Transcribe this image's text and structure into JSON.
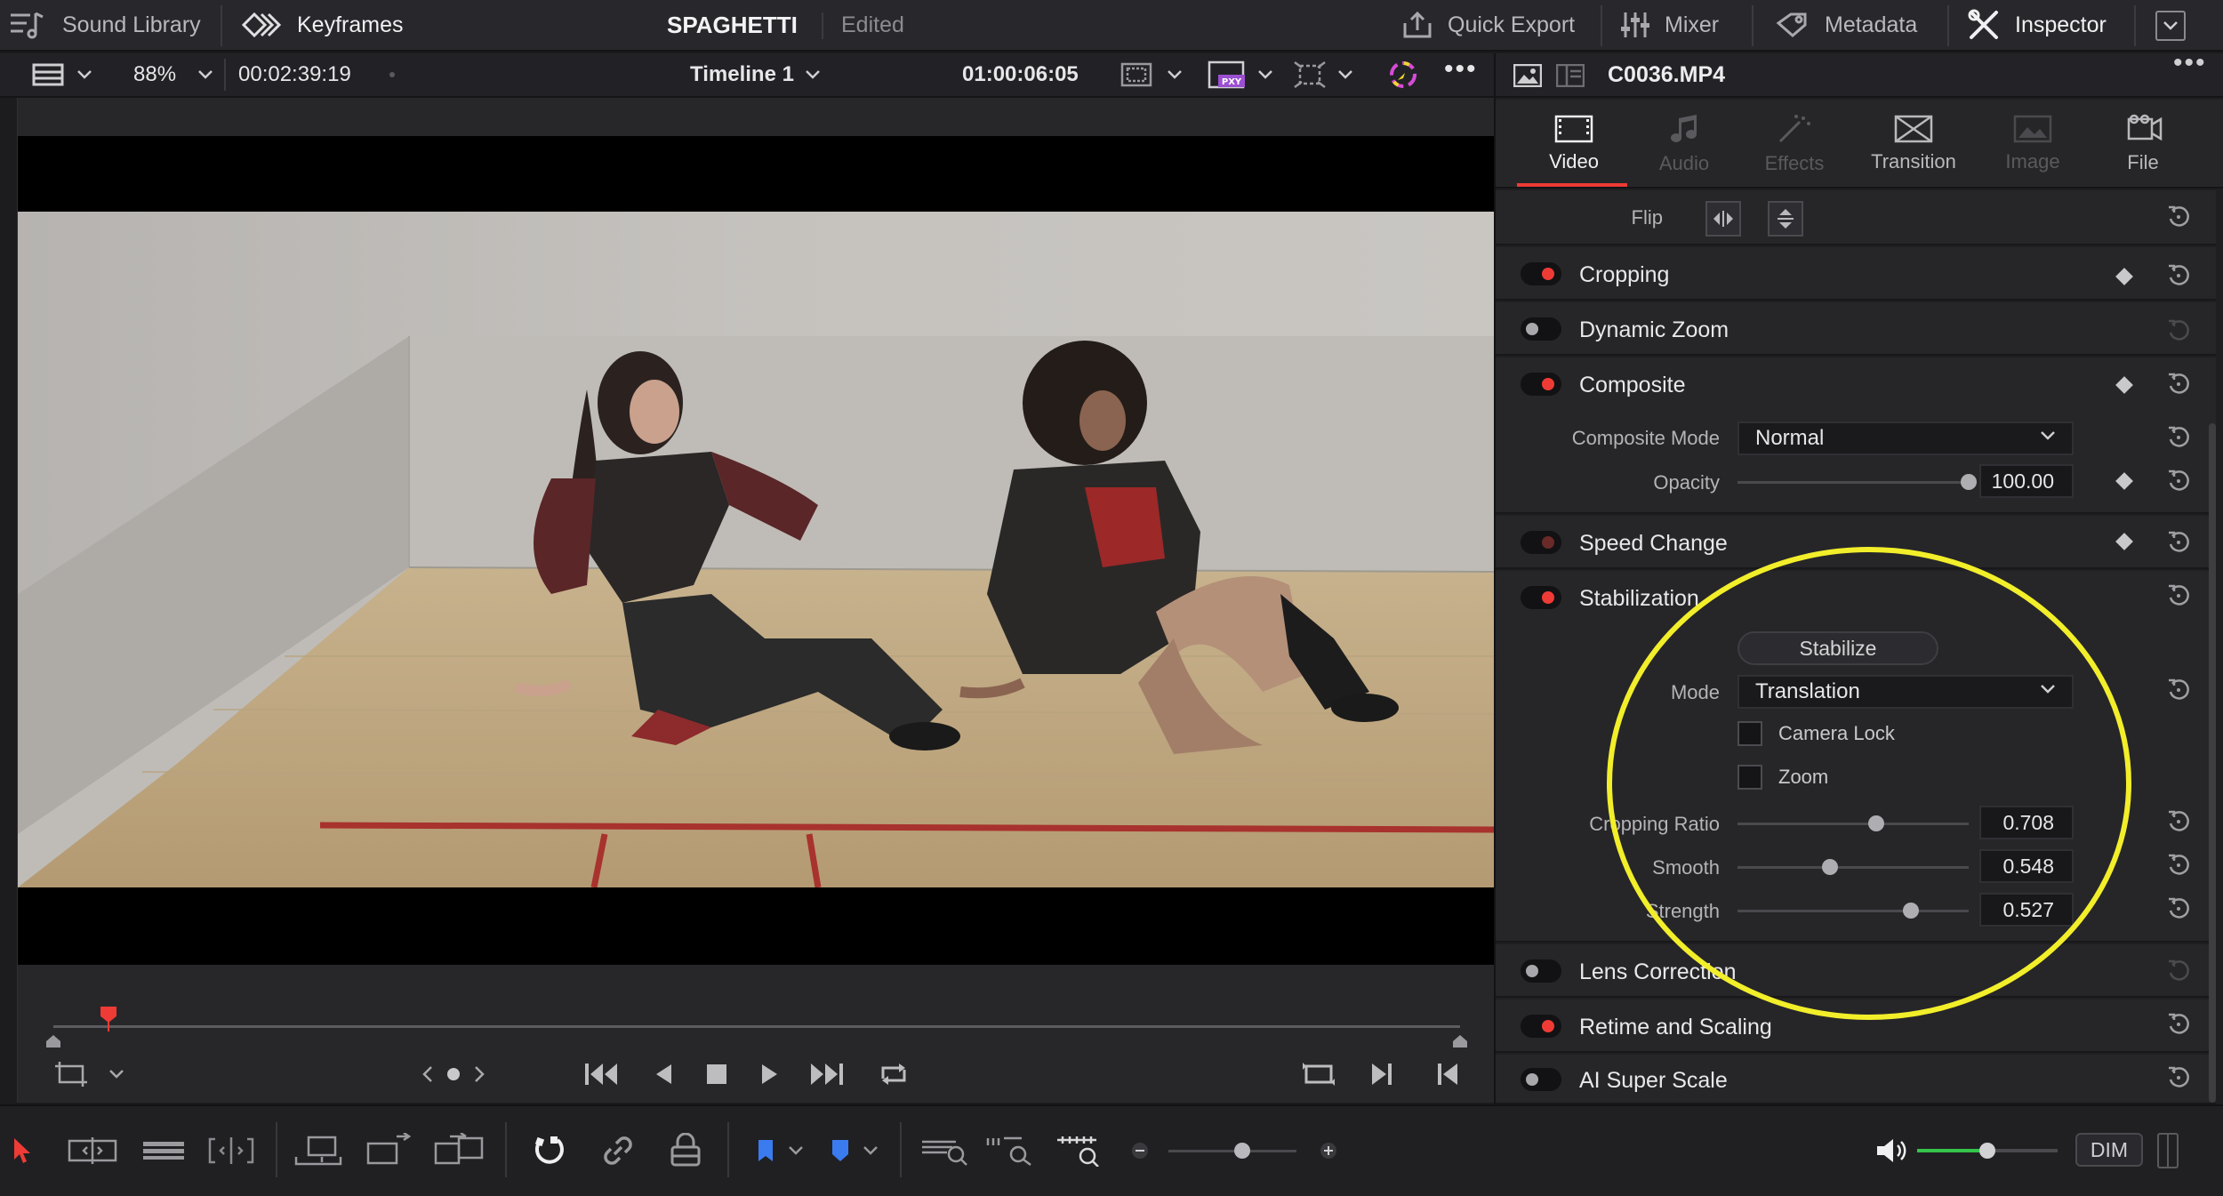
{
  "topbar": {
    "sound_library": "Sound Library",
    "keyframes": "Keyframes",
    "project_title": "SPAGHETTI",
    "project_status": "Edited",
    "quick_export": "Quick Export",
    "mixer": "Mixer",
    "metadata": "Metadata",
    "inspector": "Inspector"
  },
  "viewer_bar": {
    "zoom": "88%",
    "source_timecode": "00:02:39:19",
    "timeline_name": "Timeline 1",
    "record_timecode": "01:00:06:05"
  },
  "inspector": {
    "clip_name": "C0036.MP4",
    "tabs": [
      {
        "label": "Video",
        "icon": "film-frame-icon",
        "active": true
      },
      {
        "label": "Audio",
        "icon": "music-note-icon",
        "active": false
      },
      {
        "label": "Effects",
        "icon": "magic-wand-icon",
        "active": false
      },
      {
        "label": "Transition",
        "icon": "transition-icon",
        "active": false
      },
      {
        "label": "Image",
        "icon": "image-icon",
        "active": false
      },
      {
        "label": "File",
        "icon": "file-icon",
        "active": false
      }
    ],
    "flip_label": "Flip",
    "sections": {
      "cropping": "Cropping",
      "dynamic_zoom": "Dynamic Zoom",
      "composite": "Composite",
      "speed_change": "Speed Change",
      "stabilization": "Stabilization",
      "lens_correction": "Lens Correction",
      "retime_scaling": "Retime and Scaling",
      "ai_super_scale": "AI Super Scale"
    },
    "composite": {
      "mode_label": "Composite Mode",
      "mode_value": "Normal",
      "opacity_label": "Opacity",
      "opacity_value": "100.00",
      "opacity_level": 1.0
    },
    "stabilization": {
      "stabilize_button": "Stabilize",
      "mode_label": "Mode",
      "mode_value": "Translation",
      "camera_lock": "Camera Lock",
      "zoom": "Zoom",
      "cropping_ratio_label": "Cropping Ratio",
      "cropping_ratio_value": "0.708",
      "cropping_ratio_level": 0.6,
      "smooth_label": "Smooth",
      "smooth_value": "0.548",
      "smooth_level": 0.4,
      "strength_label": "Strength",
      "strength_value": "0.527",
      "strength_level": 0.75
    }
  },
  "bottombar": {
    "dim": "DIM"
  },
  "colors": {
    "accent_red": "#ef3b35",
    "annotation_yellow": "#f2ee2a",
    "volume_green": "#35c44a"
  }
}
